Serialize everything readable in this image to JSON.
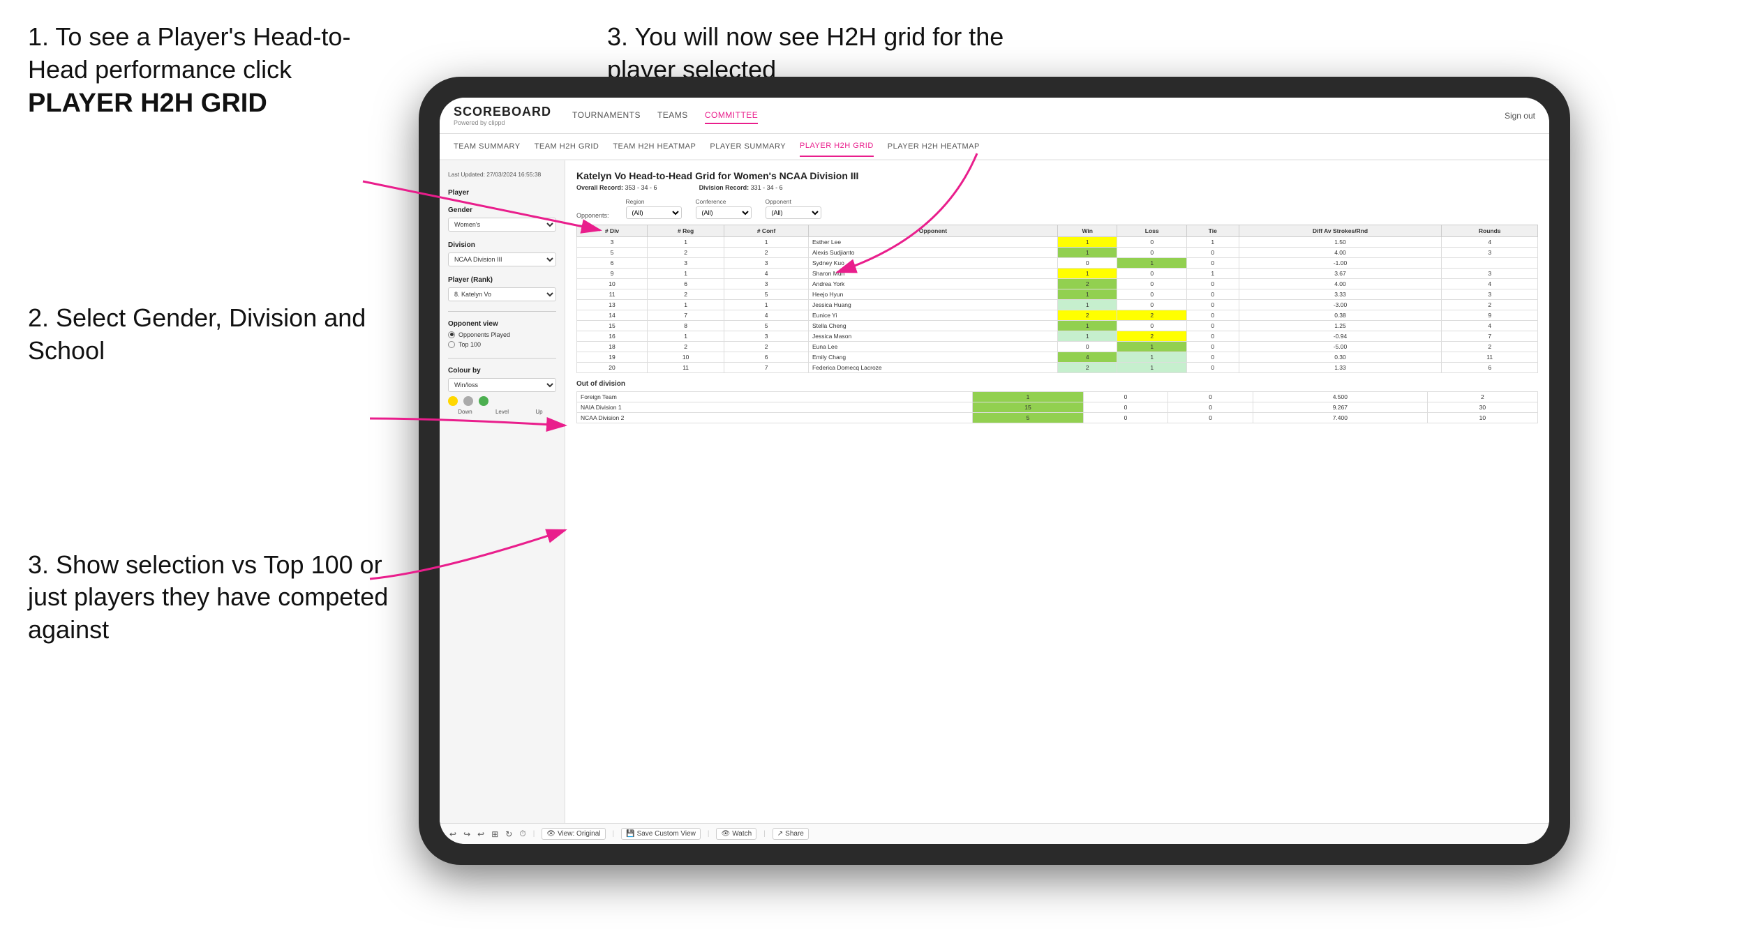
{
  "instructions": {
    "left_top": {
      "line1": "1. To see a Player's Head-to-Head performance click",
      "line2": "PLAYER H2H GRID"
    },
    "left_middle": {
      "text": "2. Select Gender, Division and School"
    },
    "left_bottom": {
      "text": "3. Show selection vs Top 100 or just players they have competed against"
    },
    "right_top": {
      "text": "3. You will now see H2H grid for the player selected"
    }
  },
  "navbar": {
    "logo": "SCOREBOARD",
    "logo_sub": "Powered by clippd",
    "items": [
      "TOURNAMENTS",
      "TEAMS",
      "COMMITTEE"
    ],
    "active_item": "COMMITTEE",
    "sign_out": "Sign out"
  },
  "sub_navbar": {
    "items": [
      "TEAM SUMMARY",
      "TEAM H2H GRID",
      "TEAM H2H HEATMAP",
      "PLAYER SUMMARY",
      "PLAYER H2H GRID",
      "PLAYER H2H HEATMAP"
    ],
    "active": "PLAYER H2H GRID"
  },
  "sidebar": {
    "last_updated": "Last Updated: 27/03/2024\n16:55:38",
    "player_label": "Player",
    "gender_label": "Gender",
    "gender_value": "Women's",
    "division_label": "Division",
    "division_value": "NCAA Division III",
    "player_rank_label": "Player (Rank)",
    "player_rank_value": "8. Katelyn Vo",
    "opponent_view_label": "Opponent view",
    "opponent_view_options": [
      "Opponents Played",
      "Top 100"
    ],
    "opponent_view_selected": "Opponents Played",
    "colour_by_label": "Colour by",
    "colour_by_value": "Win/loss",
    "colour_legend": {
      "down_label": "Down",
      "level_label": "Level",
      "up_label": "Up"
    }
  },
  "grid": {
    "title": "Katelyn Vo Head-to-Head Grid for Women's NCAA Division III",
    "overall_record_label": "Overall Record:",
    "overall_record": "353 - 34 - 6",
    "division_record_label": "Division Record:",
    "division_record": "331 - 34 - 6",
    "filters": {
      "opponents_label": "Opponents:",
      "region_label": "Region",
      "region_value": "(All)",
      "conference_label": "Conference",
      "conference_value": "(All)",
      "opponent_label": "Opponent",
      "opponent_value": "(All)"
    },
    "table_headers": [
      "# Div",
      "# Reg",
      "# Conf",
      "Opponent",
      "Win",
      "Loss",
      "Tie",
      "Diff Av Strokes/Rnd",
      "Rounds"
    ],
    "rows": [
      {
        "div": "3",
        "reg": "1",
        "conf": "1",
        "opponent": "Esther Lee",
        "win": "1",
        "loss": "0",
        "tie": "1",
        "diff": "1.50",
        "rounds": "4",
        "win_color": "yellow",
        "loss_color": "white",
        "tie_color": "white"
      },
      {
        "div": "5",
        "reg": "2",
        "conf": "2",
        "opponent": "Alexis Sudjianto",
        "win": "1",
        "loss": "0",
        "tie": "0",
        "diff": "4.00",
        "rounds": "3",
        "win_color": "green",
        "loss_color": "white",
        "tie_color": "white"
      },
      {
        "div": "6",
        "reg": "3",
        "conf": "3",
        "opponent": "Sydney Kuo",
        "win": "0",
        "loss": "1",
        "tie": "0",
        "diff": "-1.00",
        "rounds": "",
        "win_color": "white",
        "loss_color": "green",
        "tie_color": "white"
      },
      {
        "div": "9",
        "reg": "1",
        "conf": "4",
        "opponent": "Sharon Mun",
        "win": "1",
        "loss": "0",
        "tie": "1",
        "diff": "3.67",
        "rounds": "3",
        "win_color": "yellow",
        "loss_color": "white",
        "tie_color": "white"
      },
      {
        "div": "10",
        "reg": "6",
        "conf": "3",
        "opponent": "Andrea York",
        "win": "2",
        "loss": "0",
        "tie": "0",
        "diff": "4.00",
        "rounds": "4",
        "win_color": "green",
        "loss_color": "white",
        "tie_color": "white"
      },
      {
        "div": "11",
        "reg": "2",
        "conf": "5",
        "opponent": "Heejo Hyun",
        "win": "1",
        "loss": "0",
        "tie": "0",
        "diff": "3.33",
        "rounds": "3",
        "win_color": "green",
        "loss_color": "white",
        "tie_color": "white"
      },
      {
        "div": "13",
        "reg": "1",
        "conf": "1",
        "opponent": "Jessica Huang",
        "win": "1",
        "loss": "0",
        "tie": "0",
        "diff": "-3.00",
        "rounds": "2",
        "win_color": "light-green",
        "loss_color": "white",
        "tie_color": "white"
      },
      {
        "div": "14",
        "reg": "7",
        "conf": "4",
        "opponent": "Eunice Yi",
        "win": "2",
        "loss": "2",
        "tie": "0",
        "diff": "0.38",
        "rounds": "9",
        "win_color": "yellow",
        "loss_color": "yellow",
        "tie_color": "white"
      },
      {
        "div": "15",
        "reg": "8",
        "conf": "5",
        "opponent": "Stella Cheng",
        "win": "1",
        "loss": "0",
        "tie": "0",
        "diff": "1.25",
        "rounds": "4",
        "win_color": "green",
        "loss_color": "white",
        "tie_color": "white"
      },
      {
        "div": "16",
        "reg": "1",
        "conf": "3",
        "opponent": "Jessica Mason",
        "win": "1",
        "loss": "2",
        "tie": "0",
        "diff": "-0.94",
        "rounds": "7",
        "win_color": "light-green",
        "loss_color": "yellow",
        "tie_color": "white"
      },
      {
        "div": "18",
        "reg": "2",
        "conf": "2",
        "opponent": "Euna Lee",
        "win": "0",
        "loss": "1",
        "tie": "0",
        "diff": "-5.00",
        "rounds": "2",
        "win_color": "white",
        "loss_color": "green",
        "tie_color": "white"
      },
      {
        "div": "19",
        "reg": "10",
        "conf": "6",
        "opponent": "Emily Chang",
        "win": "4",
        "loss": "1",
        "tie": "0",
        "diff": "0.30",
        "rounds": "11",
        "win_color": "green",
        "loss_color": "light-green",
        "tie_color": "white"
      },
      {
        "div": "20",
        "reg": "11",
        "conf": "7",
        "opponent": "Federica Domecq Lacroze",
        "win": "2",
        "loss": "1",
        "tie": "0",
        "diff": "1.33",
        "rounds": "6",
        "win_color": "light-green",
        "loss_color": "light-green",
        "tie_color": "white"
      }
    ],
    "out_of_division_label": "Out of division",
    "out_of_division_rows": [
      {
        "team": "Foreign Team",
        "win": "1",
        "loss": "0",
        "tie": "0",
        "diff": "4.500",
        "rounds": "2",
        "win_color": "green"
      },
      {
        "team": "NAIA Division 1",
        "win": "15",
        "loss": "0",
        "tie": "0",
        "diff": "9.267",
        "rounds": "30",
        "win_color": "green"
      },
      {
        "team": "NCAA Division 2",
        "win": "5",
        "loss": "0",
        "tie": "0",
        "diff": "7.400",
        "rounds": "10",
        "win_color": "green"
      }
    ]
  },
  "toolbar": {
    "view_original": "View: Original",
    "save_custom": "Save Custom View",
    "watch": "Watch",
    "share": "Share"
  }
}
